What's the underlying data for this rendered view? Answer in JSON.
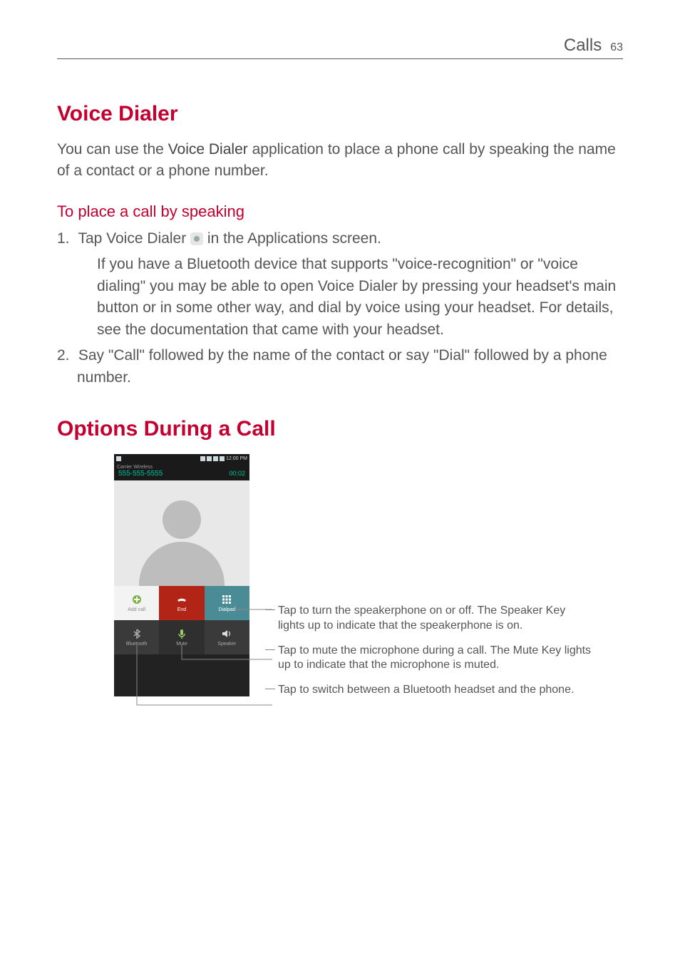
{
  "header": {
    "section": "Calls",
    "page_number": "63"
  },
  "section1": {
    "title": "Voice Dialer",
    "intro_pre": "You can use the ",
    "intro_bold": "Voice Dialer",
    "intro_post": " application to place a phone call by speaking the name of a contact or a phone number.",
    "subheading": "To place a call by speaking",
    "step1_num": "1.",
    "step1_pre": " Tap ",
    "step1_bold": "Voice Dialer",
    "step1_post": " in the Applications screen.",
    "step1_sub": "If you have a Bluetooth device that supports \"voice-recognition\" or \"voice dialing\" you may be able to open Voice Dialer by pressing your headset's main button or in some other way, and dial by voice using your headset. For details, see the documentation that came with your headset.",
    "step2_num": "2.",
    "step2_a": " Say \"",
    "step2_b1": "Call",
    "step2_c": "\" followed by the name of the contact or say \"",
    "step2_b2": "Dial",
    "step2_d": "\" followed by a phone number."
  },
  "section2": {
    "title": "Options During a Call",
    "phone": {
      "status_time": "12:00 PM",
      "carrier": "Carrier Wireless",
      "number": "555-555-5555",
      "timer": "00:02",
      "buttons": {
        "add_call": "Add call",
        "end": "End",
        "dialpad": "Dialpad",
        "bluetooth": "Bluetooth",
        "mute": "Mute",
        "speaker": "Speaker"
      }
    },
    "callouts": {
      "speaker": "Tap to turn the speakerphone on or off. The Speaker Key lights up to indicate that the speakerphone is on.",
      "mute": "Tap to mute the microphone during a call. The Mute Key lights up to indicate that the microphone is muted.",
      "bluetooth": "Tap to switch between a Bluetooth headset and the phone."
    }
  }
}
